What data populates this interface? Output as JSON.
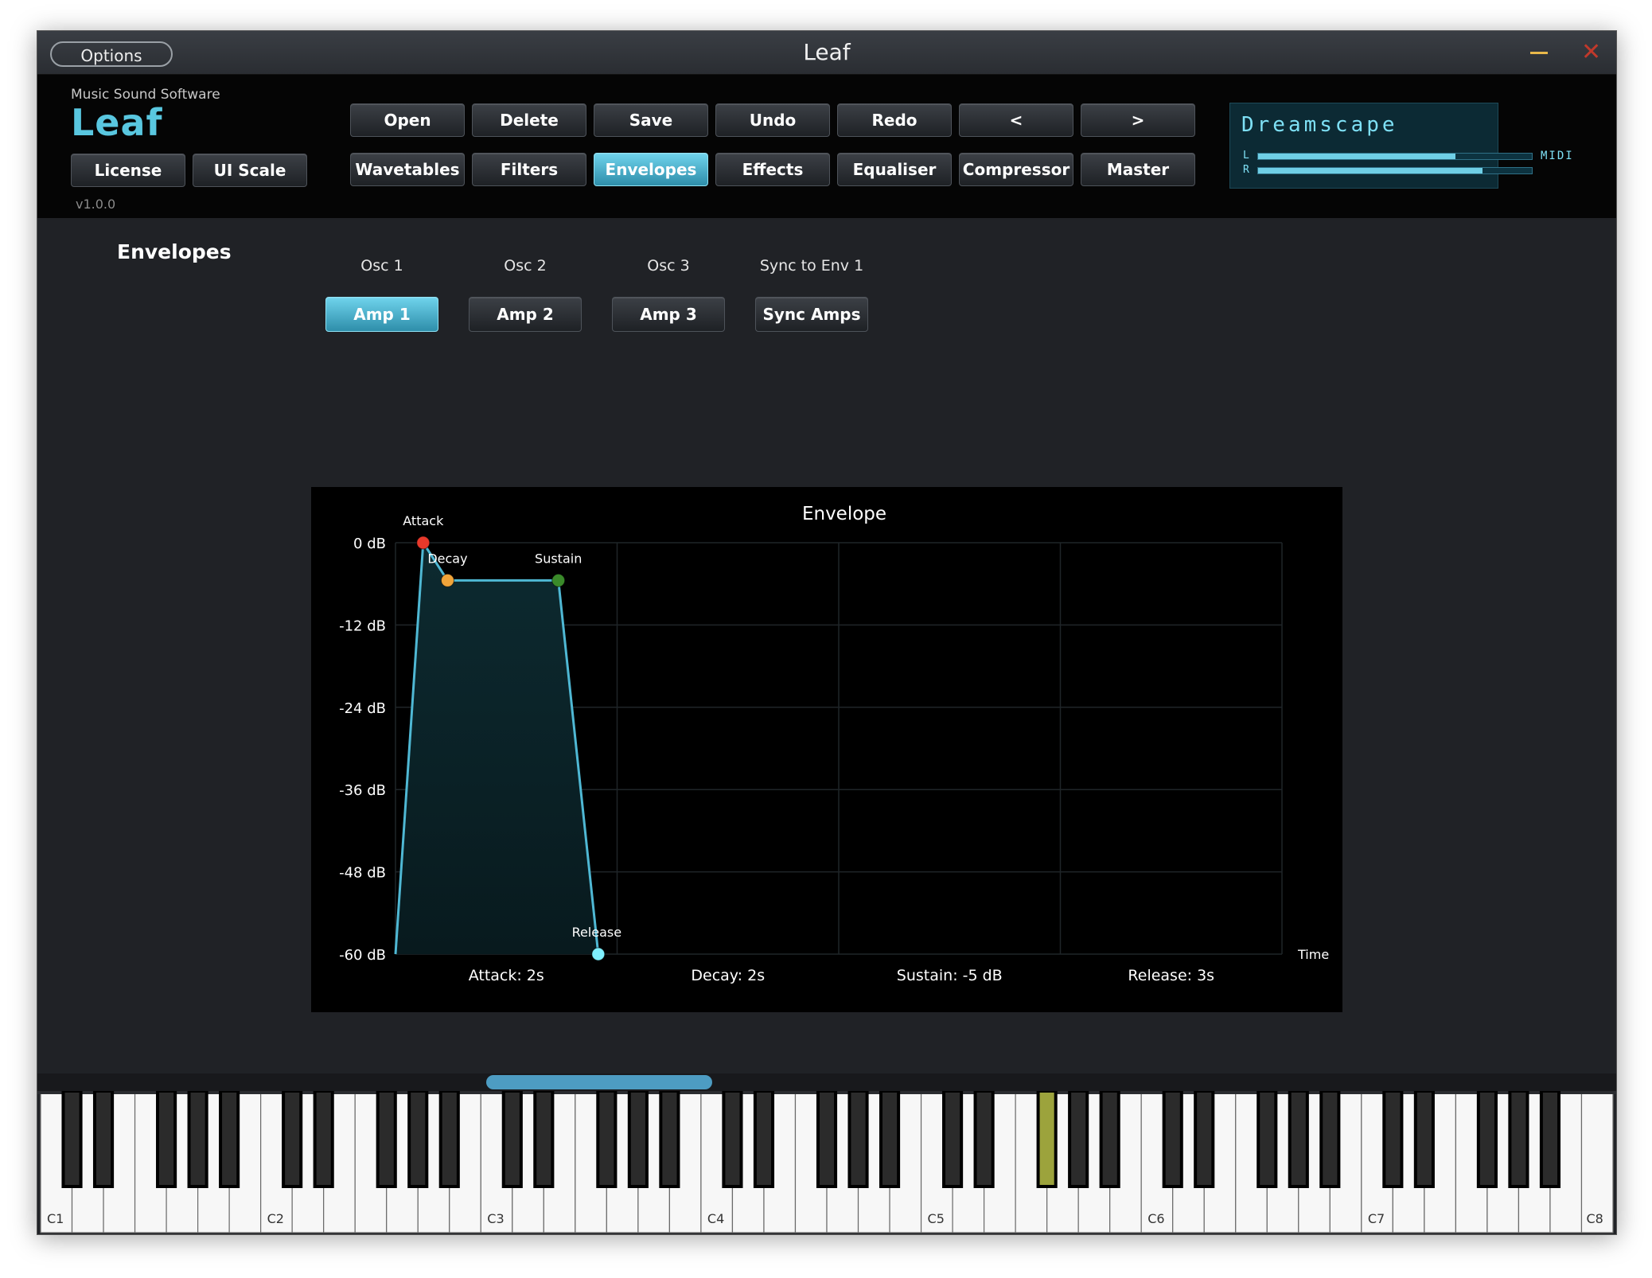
{
  "window": {
    "title": "Leaf",
    "options_label": "Options",
    "close_glyph": "✕"
  },
  "brand": {
    "company": "Music Sound Software",
    "logo": "Leaf",
    "version": "v1.0.0",
    "license_label": "License",
    "uiscale_label": "UI Scale"
  },
  "toolbar": {
    "row1": [
      "Open",
      "Delete",
      "Save",
      "Undo",
      "Redo",
      "<",
      ">"
    ],
    "row2": [
      "Wavetables",
      "Filters",
      "Envelopes",
      "Effects",
      "Equaliser",
      "Compressor",
      "Master"
    ],
    "active": "Envelopes"
  },
  "display": {
    "preset": "Dreamscape",
    "left_label": "L",
    "right_label": "R",
    "midi_label": "MIDI",
    "left_level": 0.72,
    "right_level": 0.82
  },
  "section": {
    "title": "Envelopes",
    "columns": [
      {
        "label": "Osc 1",
        "button": "Amp 1",
        "active": true
      },
      {
        "label": "Osc 2",
        "button": "Amp 2",
        "active": false
      },
      {
        "label": "Osc 3",
        "button": "Amp 3",
        "active": false
      },
      {
        "label": "Sync to Env 1",
        "button": "Sync Amps",
        "active": false
      }
    ]
  },
  "chart_data": {
    "type": "line",
    "title": "Envelope",
    "xlabel": "Time",
    "ylabel": "",
    "ylim": [
      -60,
      0
    ],
    "yticks": [
      "0 dB",
      "-12 dB",
      "-24 dB",
      "-36 dB",
      "-48 dB",
      "-60 dB"
    ],
    "xlim": [
      0,
      8
    ],
    "points": [
      {
        "x": 0,
        "y": -60,
        "label": ""
      },
      {
        "x": 0.25,
        "y": 0,
        "label": "Attack",
        "color": "#e8392b"
      },
      {
        "x": 0.47,
        "y": -5.5,
        "label": "Decay",
        "color": "#f0a43a"
      },
      {
        "x": 1.47,
        "y": -5.5,
        "label": "Sustain",
        "color": "#3a8a2a"
      },
      {
        "x": 1.83,
        "y": -60,
        "label": "Release",
        "color": "#7ff0ff"
      }
    ],
    "params": [
      "Attack: 2s",
      "Decay: 2s",
      "Sustain: -5 dB",
      "Release: 3s"
    ],
    "grid": true,
    "line_color": "#4fb8d4"
  },
  "keyboard": {
    "octave_labels": [
      "C1",
      "C2",
      "C3",
      "C4",
      "C5",
      "C6",
      "C7",
      "C8"
    ],
    "highlighted_black_key_index": 22,
    "highlight_color": "#9ca33c"
  }
}
